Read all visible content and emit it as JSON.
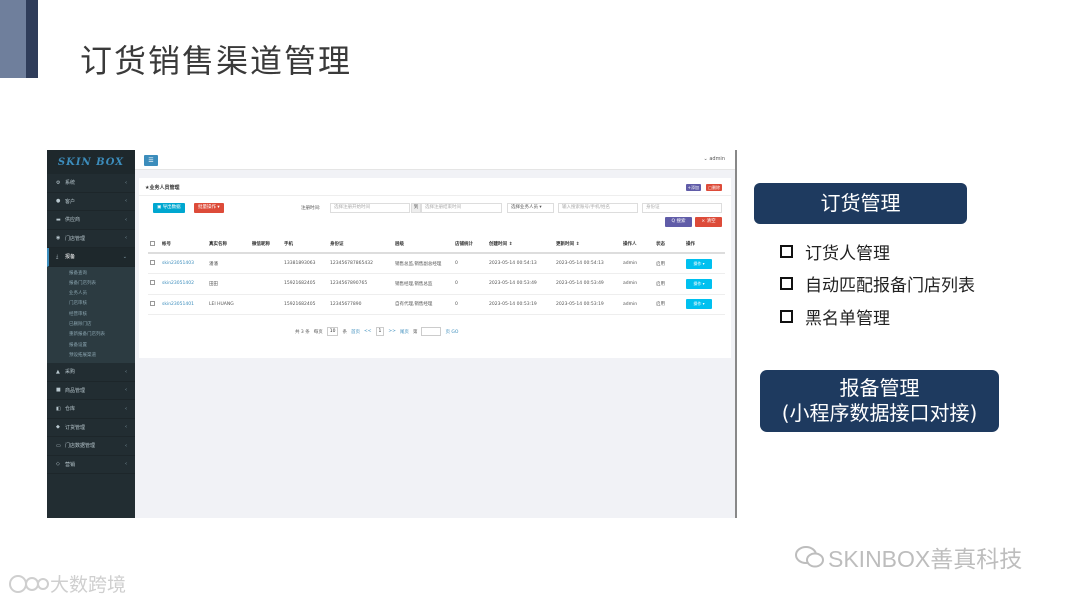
{
  "slide": {
    "title": "订货销售渠道管理",
    "box1": "订货管理",
    "bullets": [
      "订货人管理",
      "自动匹配报备门店列表",
      "黑名单管理"
    ],
    "box2_line1": "报备管理",
    "box2_line2": "(小程序数据接口对接)",
    "watermark": "SKINBOX善真科技",
    "corner_logo": "大数跨境"
  },
  "app": {
    "logo": "SKIN BOX",
    "user": "admin",
    "nav": [
      {
        "label": "系统",
        "icon": "gears-icon"
      },
      {
        "label": "客户",
        "icon": "user-icon"
      },
      {
        "label": "供应商",
        "icon": "truck-icon"
      },
      {
        "label": "门店管理",
        "icon": "location-icon"
      },
      {
        "label": "报备",
        "icon": "download-icon",
        "active": true
      }
    ],
    "sub_items": [
      "报备查询",
      "报备门店列表",
      "业务人员",
      "门店审核",
      "经营审核",
      "已删除门店",
      "重新报备门店列表",
      "报备设置",
      "预设拓展渠道"
    ],
    "nav_bottom": [
      {
        "label": "采购",
        "icon": "cart-icon"
      },
      {
        "label": "商品管理",
        "icon": "box-icon"
      },
      {
        "label": "仓库",
        "icon": "warehouse-icon"
      },
      {
        "label": "订货管理",
        "icon": "tag-icon"
      },
      {
        "label": "门店数据管理",
        "icon": "monitor-icon"
      },
      {
        "label": "营销",
        "icon": "diamond-icon"
      }
    ],
    "panel_title": "★业务人员管理",
    "add_label": "+添加",
    "del_label": "删除",
    "export_label": "导出数据",
    "batch_label": "批量操作 ▾",
    "filter": {
      "reg_time_label": "注册时间:",
      "start_placeholder": "选择注册开始时间",
      "to": "到",
      "end_placeholder": "选择注册结束时间",
      "staff_select": "选择业务人员 ▾",
      "keyword_placeholder": "输入搜索账号/手机/姓名",
      "id_placeholder": "身份证",
      "search": "Q 搜索",
      "clear": "× 清空"
    },
    "columns": [
      "",
      "帐号",
      "真实名称",
      "微信昵称",
      "手机",
      "身份证",
      "层级",
      "店铺统计",
      "创建时间 ⇕",
      "更新时间 ⇕",
      "操作人",
      "状态",
      "操作"
    ],
    "rows": [
      [
        "",
        "skin23051403",
        "潘潘",
        "",
        "13381893063",
        "123456787865432",
        "销售总监,销售副总经理",
        "0",
        "2023-05-14 00:54:13",
        "2023-05-14 00:54:13",
        "admin",
        "启用",
        "操作 ▾"
      ],
      [
        "",
        "skin23051402",
        "田田",
        "",
        "15921682405",
        "1234567890765",
        "销售经理,销售总监",
        "0",
        "2023-05-14 00:53:49",
        "2023-05-14 00:53:49",
        "admin",
        "启用",
        "操作 ▾"
      ],
      [
        "",
        "skin23051401",
        "LEI HUANG",
        "",
        "15921682405",
        "12345677890",
        "自有代理,销售经理",
        "0",
        "2023-05-14 00:53:19",
        "2023-05-14 00:53:19",
        "admin",
        "启用",
        "操作 ▾"
      ]
    ],
    "pager": {
      "total": "共 3 条",
      "per_page_label": "每页",
      "per_page": "10",
      "unit": "条",
      "first": "首页",
      "prev": "<<",
      "current": "1",
      "next": ">>",
      "last": "尾页",
      "goto_label": "第",
      "goto_unit": "页 GO"
    }
  }
}
